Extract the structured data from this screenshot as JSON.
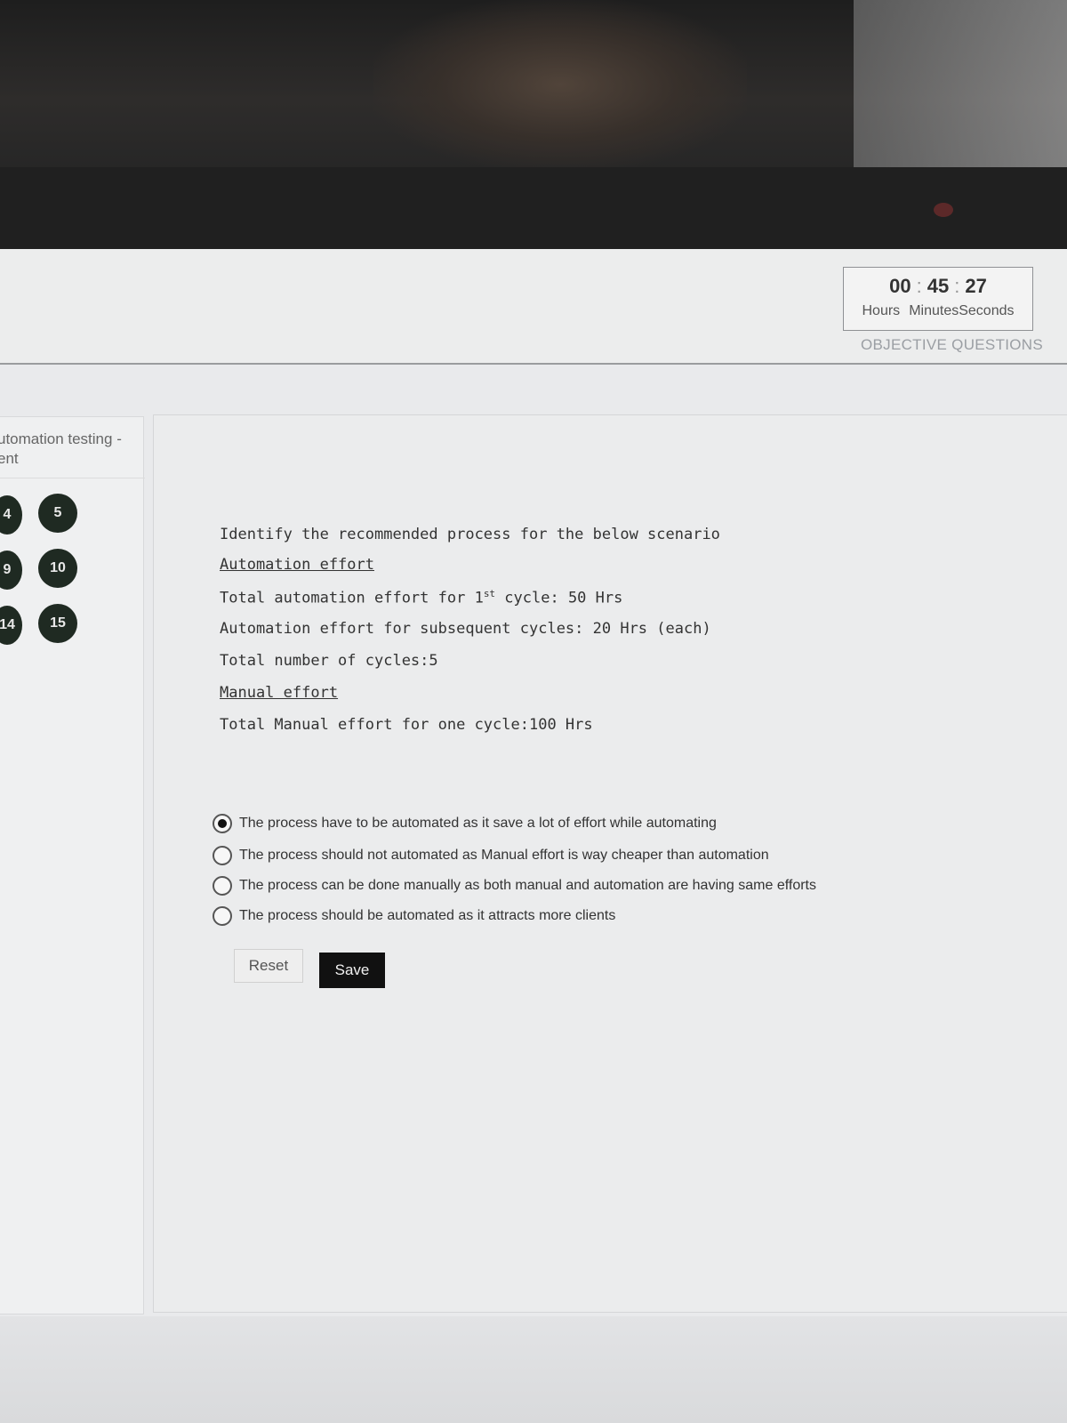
{
  "timer": {
    "hours": "00",
    "minutes": "45",
    "seconds": "27",
    "hours_label": "Hours",
    "minutes_label": "Minutes",
    "seconds_label": "Seconds"
  },
  "section_tab": "OBJECTIVE QUESTIONS",
  "sidebar": {
    "title_line1": "utomation testing -",
    "title_line2": "ent",
    "question_numbers": [
      "4",
      "5",
      "9",
      "10",
      "14",
      "15"
    ]
  },
  "question": {
    "prompt": "Identify the recommended process for the below scenario",
    "automation_heading": "Automation effort",
    "auto_first_prefix": "Total automation effort for 1",
    "auto_first_sup": "st",
    "auto_first_suffix": " cycle: 50 Hrs",
    "auto_subsequent": "Automation effort for subsequent cycles: 20 Hrs (each)",
    "total_cycles": "Total number of cycles:5",
    "manual_heading": "Manual effort",
    "manual_total": "Total Manual effort for one cycle:100 Hrs"
  },
  "options": [
    {
      "label": "The process have to be automated as it save a lot of effort while automating",
      "selected": true
    },
    {
      "label": "The process should not automated as Manual effort is way cheaper than automation",
      "selected": false
    },
    {
      "label": "The process can be done manually as both manual and automation are having same efforts",
      "selected": false
    },
    {
      "label": "The process should be automated as it attracts more clients",
      "selected": false
    }
  ],
  "buttons": {
    "reset": "Reset",
    "save": "Save"
  }
}
